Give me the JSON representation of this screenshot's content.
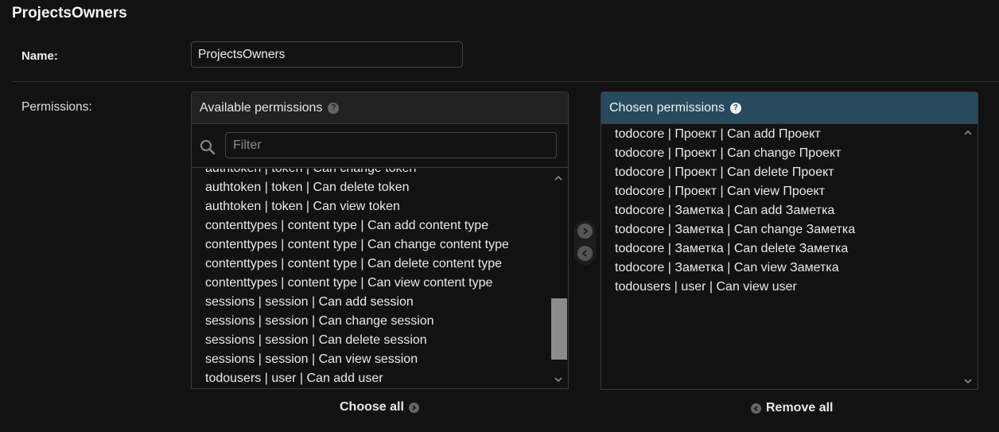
{
  "page": {
    "title": "ProjectsOwners"
  },
  "name_field": {
    "label": "Name:",
    "value": "ProjectsOwners"
  },
  "permissions": {
    "label": "Permissions:",
    "available": {
      "title": "Available permissions",
      "filter_placeholder": "Filter",
      "items": [
        "authtoken | token | Can change token",
        "authtoken | token | Can delete token",
        "authtoken | token | Can view token",
        "contenttypes | content type | Can add content type",
        "contenttypes | content type | Can change content type",
        "contenttypes | content type | Can delete content type",
        "contenttypes | content type | Can view content type",
        "sessions | session | Can add session",
        "sessions | session | Can change session",
        "sessions | session | Can delete session",
        "sessions | session | Can view session",
        "todousers | user | Can add user"
      ],
      "choose_all_label": "Choose all"
    },
    "chosen": {
      "title": "Chosen permissions",
      "items": [
        "todocore | Проект | Can add Проект",
        "todocore | Проект | Can change Проект",
        "todocore | Проект | Can delete Проект",
        "todocore | Проект | Can view Проект",
        "todocore | Заметка | Can add Заметка",
        "todocore | Заметка | Can change Заметка",
        "todocore | Заметка | Can delete Заметка",
        "todocore | Заметка | Can view Заметка",
        "todousers | user | Can view user"
      ],
      "remove_all_label": "Remove all"
    }
  },
  "colors": {
    "chosen_header": "#264b5d",
    "background": "#121212"
  },
  "icons": [
    "help-icon",
    "search-icon",
    "arrow-right-icon",
    "arrow-left-icon",
    "chevron-up-icon",
    "chevron-down-icon"
  ]
}
